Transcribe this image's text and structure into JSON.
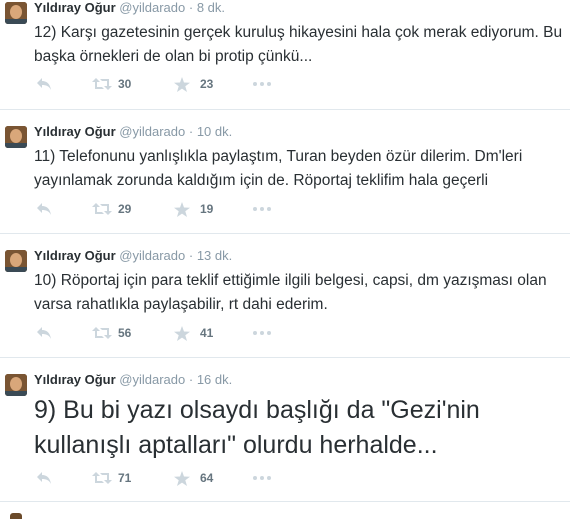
{
  "tweets": [
    {
      "name": "Yıldıray Oğur",
      "handle": "@yildarado",
      "separator": "·",
      "time": "8 dk.",
      "text": "12) Karşı gazetesinin gerçek kuruluş hikayesini hala çok merak ediyorum. Bu başka örnekleri de olan bi protip çünkü...",
      "retweets": "30",
      "favorites": "23"
    },
    {
      "name": "Yıldıray Oğur",
      "handle": "@yildarado",
      "separator": "·",
      "time": "10 dk.",
      "text": "11) Telefonunu yanlışlıkla paylaştım, Turan beyden özür dilerim. Dm'leri yayınlamak zorunda kaldığım için de. Röportaj teklifim hala geçerli",
      "retweets": "29",
      "favorites": "19"
    },
    {
      "name": "Yıldıray Oğur",
      "handle": "@yildarado",
      "separator": "·",
      "time": "13 dk.",
      "text": "10) Röportaj için para teklif ettiğimle ilgili belgesi, capsi, dm yazışması olan varsa rahatlıkla paylaşabilir, rt dahi ederim.",
      "retweets": "56",
      "favorites": "41"
    },
    {
      "name": "Yıldıray Oğur",
      "handle": "@yildarado",
      "separator": "·",
      "time": "16 dk.",
      "text": "9) Bu bi yazı olsaydı başlığı da \"Gezi'nin kullanışlı aptalları\" olurdu herhalde...",
      "retweets": "71",
      "favorites": "64"
    }
  ],
  "icons": {
    "reply": "reply-arrow",
    "retweet": "retweet-arrows",
    "favorite": "star",
    "more": "ellipsis"
  },
  "colors": {
    "text": "#292f33",
    "muted": "#8899a6",
    "icon": "#ccd6dd",
    "divider": "#e1e8ed"
  }
}
